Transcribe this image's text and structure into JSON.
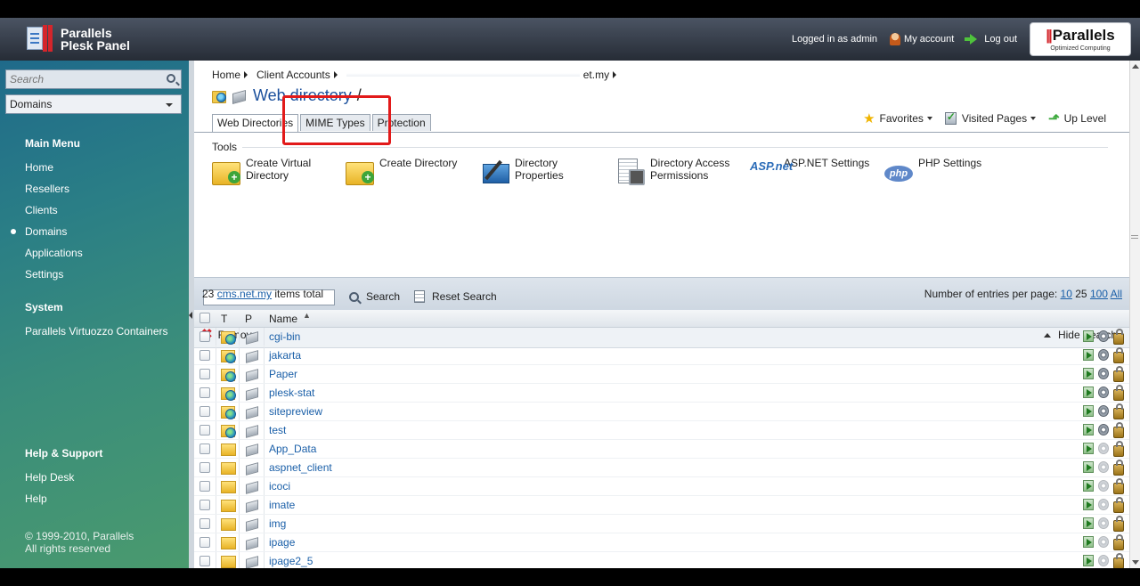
{
  "header": {
    "brand_line1": "Parallels",
    "brand_line2": "Plesk Panel",
    "logged_in": "Logged in as admin",
    "my_account": "My account",
    "log_out": "Log out",
    "logo_text": "Parallels",
    "logo_tagline": "Optimized Computing"
  },
  "sidebar": {
    "search_placeholder": "Search",
    "domain_select": "Domains",
    "main_menu_title": "Main Menu",
    "main_menu": [
      "Home",
      "Resellers",
      "Clients",
      "Domains",
      "Applications",
      "Settings"
    ],
    "active_item": "Domains",
    "system_title": "System",
    "system_items": [
      "Parallels Virtuozzo Containers"
    ],
    "help_title": "Help & Support",
    "help_items": [
      "Help Desk",
      "Help"
    ],
    "copyright_line1": "© 1999-2010, Parallels",
    "copyright_line2": "All rights reserved"
  },
  "breadcrumb": [
    "Home",
    "Client Accounts",
    "et.my"
  ],
  "page": {
    "title": "Web directory",
    "title_suffix": "/"
  },
  "tabs": [
    "Web Directories",
    "MIME Types",
    "Protection"
  ],
  "active_tab": "Web Directories",
  "nav": {
    "favorites": "Favorites",
    "visited": "Visited Pages",
    "up_level": "Up Level"
  },
  "tools": {
    "label": "Tools",
    "items": [
      {
        "line1": "Create Virtual",
        "line2": "Directory",
        "icon": "folder-add-icon"
      },
      {
        "line1": "Create Directory",
        "line2": "",
        "icon": "folder-add-icon"
      },
      {
        "line1": "Directory",
        "line2": "Properties",
        "icon": "directory-properties-icon"
      },
      {
        "line1": "Directory Access",
        "line2": "Permissions",
        "icon": "permissions-icon"
      },
      {
        "line1": "ASP.NET Settings",
        "line2": "",
        "icon": "aspnet-icon"
      },
      {
        "line1": "PHP Settings",
        "line2": "",
        "icon": "php-icon"
      }
    ],
    "asp_icon_text": "ASP.net",
    "php_icon_text": "php"
  },
  "search": {
    "value": "",
    "search_label": "Search",
    "reset_label": "Reset Search"
  },
  "actions": {
    "remove": "Remove",
    "hide_search": "Hide Search"
  },
  "summary": {
    "count": "23",
    "domain": "cms.net.my",
    "suffix": "items total",
    "per_page_label": "Number of entries per page:",
    "per_page_options": [
      "10",
      "25",
      "100",
      "All"
    ],
    "per_page_selected": "25"
  },
  "table": {
    "columns": [
      "T",
      "P",
      "Name"
    ],
    "rows": [
      {
        "name": "cgi-bin",
        "type": "web"
      },
      {
        "name": "jakarta",
        "type": "web"
      },
      {
        "name": "Paper",
        "type": "web"
      },
      {
        "name": "plesk-stat",
        "type": "web"
      },
      {
        "name": "sitepreview",
        "type": "web"
      },
      {
        "name": "test",
        "type": "web"
      },
      {
        "name": "App_Data",
        "type": "plain"
      },
      {
        "name": "aspnet_client",
        "type": "plain"
      },
      {
        "name": "icoci",
        "type": "plain"
      },
      {
        "name": "imate",
        "type": "plain"
      },
      {
        "name": "img",
        "type": "plain"
      },
      {
        "name": "ipage",
        "type": "plain"
      },
      {
        "name": "ipage2_5",
        "type": "plain"
      }
    ]
  }
}
